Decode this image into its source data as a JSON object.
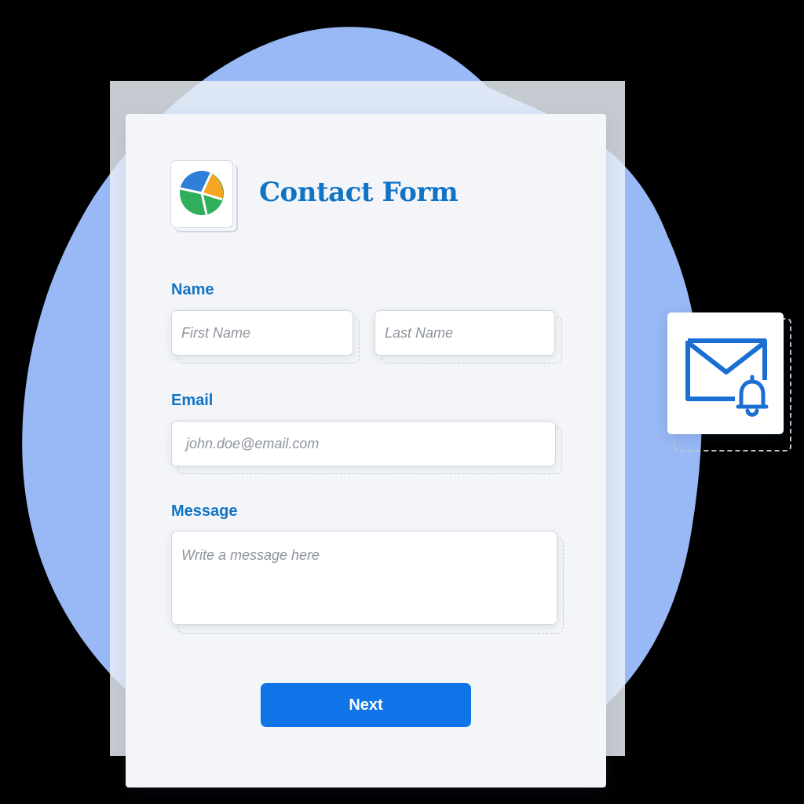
{
  "form": {
    "title": "Contact Form",
    "name_label": "Name",
    "first_name_placeholder": "First Name",
    "last_name_placeholder": "Last Name",
    "email_label": "Email",
    "email_placeholder": "john.doe@email.com",
    "message_label": "Message",
    "message_placeholder": "Write a message here",
    "next_label": "Next"
  },
  "icons": {
    "logo": "pie-chart-logo-icon",
    "notification": "mail-bell-icon"
  },
  "colors": {
    "accent": "#1173c4",
    "button": "#0f74e8",
    "blob": "#98b9f5",
    "logo_blue": "#2f7fd8",
    "logo_orange": "#f5a623",
    "logo_green": "#2fae5c"
  }
}
